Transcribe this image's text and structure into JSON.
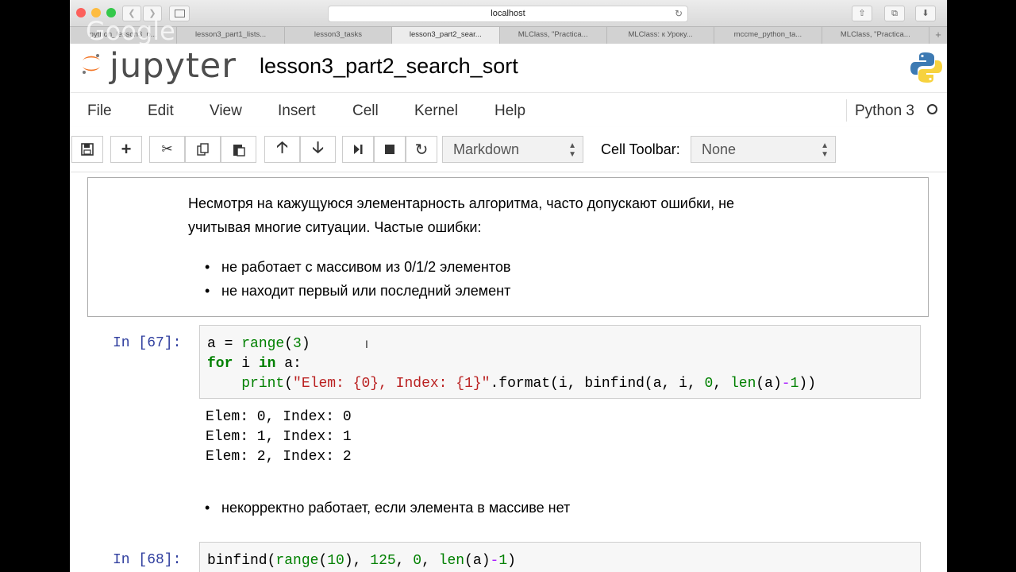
{
  "browser": {
    "url": "localhost",
    "tabs": [
      "python_lesson3_p...",
      "lesson3_part1_lists...",
      "lesson3_tasks",
      "lesson3_part2_sear...",
      "MLClass, \"Practica...",
      "MLClass: к Уроку...",
      "mccme_python_ta...",
      "MLClass, \"Practica..."
    ],
    "active_tab": 3,
    "watermark": "Google"
  },
  "jupyter": {
    "logo_text": "jupyter",
    "notebook_title": "lesson3_part2_search_sort",
    "menu": [
      "File",
      "Edit",
      "View",
      "Insert",
      "Cell",
      "Kernel",
      "Help"
    ],
    "kernel": "Python 3",
    "toolbar": {
      "cell_type": "Markdown",
      "cell_toolbar_label": "Cell Toolbar:",
      "cell_toolbar_value": "None"
    }
  },
  "cells": {
    "md1": {
      "line1": "Несмотря на кажущуюся элементарность алгоритма, часто допускают ошибки, не",
      "line2": "учитывая многие ситуации. Частые ошибки:",
      "bullets": [
        "не работает с массивом из 0/1/2 элементов",
        "не находит первый или последний элемент"
      ]
    },
    "code67": {
      "prompt": "In [67]:",
      "line1": {
        "a": "a = ",
        "b": "range",
        "c": "(",
        "d": "3",
        "e": ")"
      },
      "line2": {
        "a": "for",
        "b": " i ",
        "c": "in",
        "d": " a:"
      },
      "line3": {
        "indent": "    ",
        "fn": "print",
        "p1": "(",
        "s": "\"Elem: {0}, Index: {1}\"",
        "mid": ".format(i, binfind(a, i, ",
        "n0": "0",
        "c1": ", ",
        "len": "len",
        "tail": "(a)",
        "minus": "-",
        "n1": "1",
        "end": "))"
      },
      "output": [
        "Elem: 0, Index: 0",
        "Elem: 1, Index: 1",
        "Elem: 2, Index: 2"
      ]
    },
    "md2": {
      "bullet": "некорректно работает, если элемента в массиве нет"
    },
    "code68": {
      "prompt": "In [68]:",
      "line1": {
        "a": "binfind(",
        "b": "range",
        "c": "(",
        "d": "10",
        "e": "), ",
        "f": "125",
        "g": ", ",
        "h": "0",
        "i": ", ",
        "j": "len",
        "k": "(a)",
        "l": "-",
        "m": "1",
        "n": ")"
      }
    }
  }
}
